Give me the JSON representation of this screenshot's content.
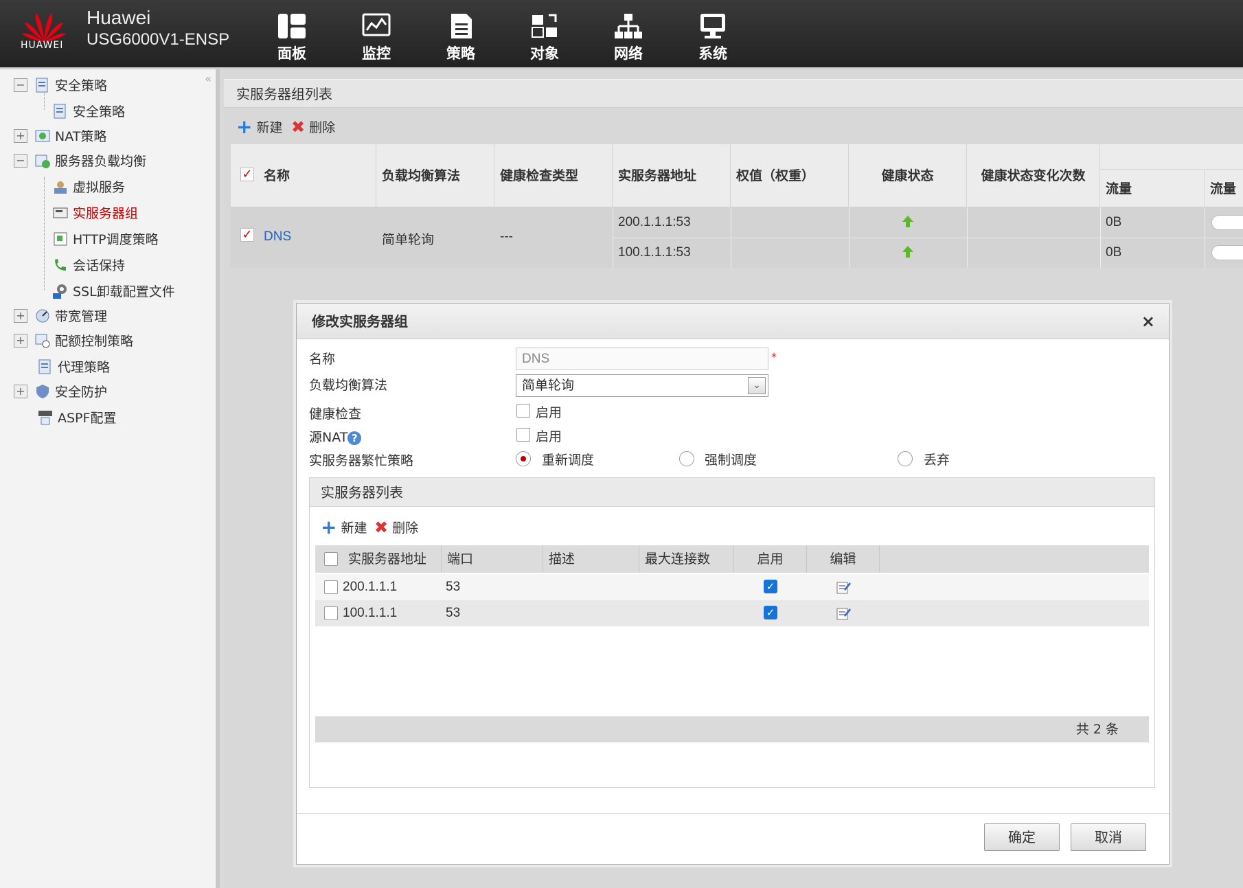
{
  "app": {
    "brand": "Huawei",
    "model": "USG6000V1-ENSP",
    "logo_text": "HUAWEI"
  },
  "nav": [
    {
      "label": "面板",
      "icon": "dashboard-icon"
    },
    {
      "label": "监控",
      "icon": "monitor-icon"
    },
    {
      "label": "策略",
      "icon": "policy-icon"
    },
    {
      "label": "对象",
      "icon": "object-icon"
    },
    {
      "label": "网络",
      "icon": "network-icon"
    },
    {
      "label": "系统",
      "icon": "system-icon"
    }
  ],
  "sidebar": {
    "items": [
      {
        "label": "安全策略"
      },
      {
        "label": "安全策略"
      },
      {
        "label": "NAT策略"
      },
      {
        "label": "服务器负载均衡"
      },
      {
        "label": "虚拟服务"
      },
      {
        "label": "实服务器组"
      },
      {
        "label": "HTTP调度策略"
      },
      {
        "label": "会话保持"
      },
      {
        "label": "SSL卸载配置文件"
      },
      {
        "label": "带宽管理"
      },
      {
        "label": "配额控制策略"
      },
      {
        "label": "代理策略"
      },
      {
        "label": "安全防护"
      },
      {
        "label": "ASPF配置"
      }
    ],
    "collapse_glyph": "«",
    "expanded_glyph": "−",
    "collapsed_glyph": "+"
  },
  "main": {
    "title": "实服务器组列表",
    "new_label": "新建",
    "delete_label": "删除",
    "columns": [
      "名称",
      "负载均衡算法",
      "健康检查类型",
      "实服务器地址",
      "权值（权重）",
      "健康状态",
      "健康状态变化次数",
      "流量",
      "流量"
    ],
    "row": {
      "name": "DNS",
      "algorithm": "简单轮询",
      "health_type": "---",
      "servers": [
        {
          "address": "200.1.1.1:53",
          "traffic": "0B"
        },
        {
          "address": "100.1.1.1:53",
          "traffic": "0B"
        }
      ]
    },
    "check_glyph": "✓"
  },
  "dialog": {
    "title": "修改实服务器组",
    "close_glyph": "×",
    "name_label": "名称",
    "name_value": "DNS",
    "required_mark": "*",
    "algorithm_label": "负载均衡算法",
    "algorithm_value": "简单轮询",
    "select_arrow": "⌄",
    "health_label": "健康检查",
    "health_option": "启用",
    "snat_label": "源NAT",
    "snat_help": "?",
    "snat_option": "启用",
    "busy_label": "实服务器繁忙策略",
    "busy_options": [
      "重新调度",
      "强制调度",
      "丢弃"
    ],
    "busy_selected": "重新调度",
    "sub": {
      "title": "实服务器列表",
      "new_label": "新建",
      "delete_label": "删除",
      "columns": [
        "实服务器地址",
        "端口",
        "描述",
        "最大连接数",
        "启用",
        "编辑"
      ],
      "rows": [
        {
          "address": "200.1.1.1",
          "port": "53",
          "description": "",
          "max_conn": "",
          "enabled": true
        },
        {
          "address": "100.1.1.1",
          "port": "53",
          "description": "",
          "max_conn": "",
          "enabled": true
        }
      ],
      "enabled_glyph": "✓",
      "footer": "共 2 条"
    },
    "ok_label": "确定",
    "cancel_label": "取消"
  }
}
